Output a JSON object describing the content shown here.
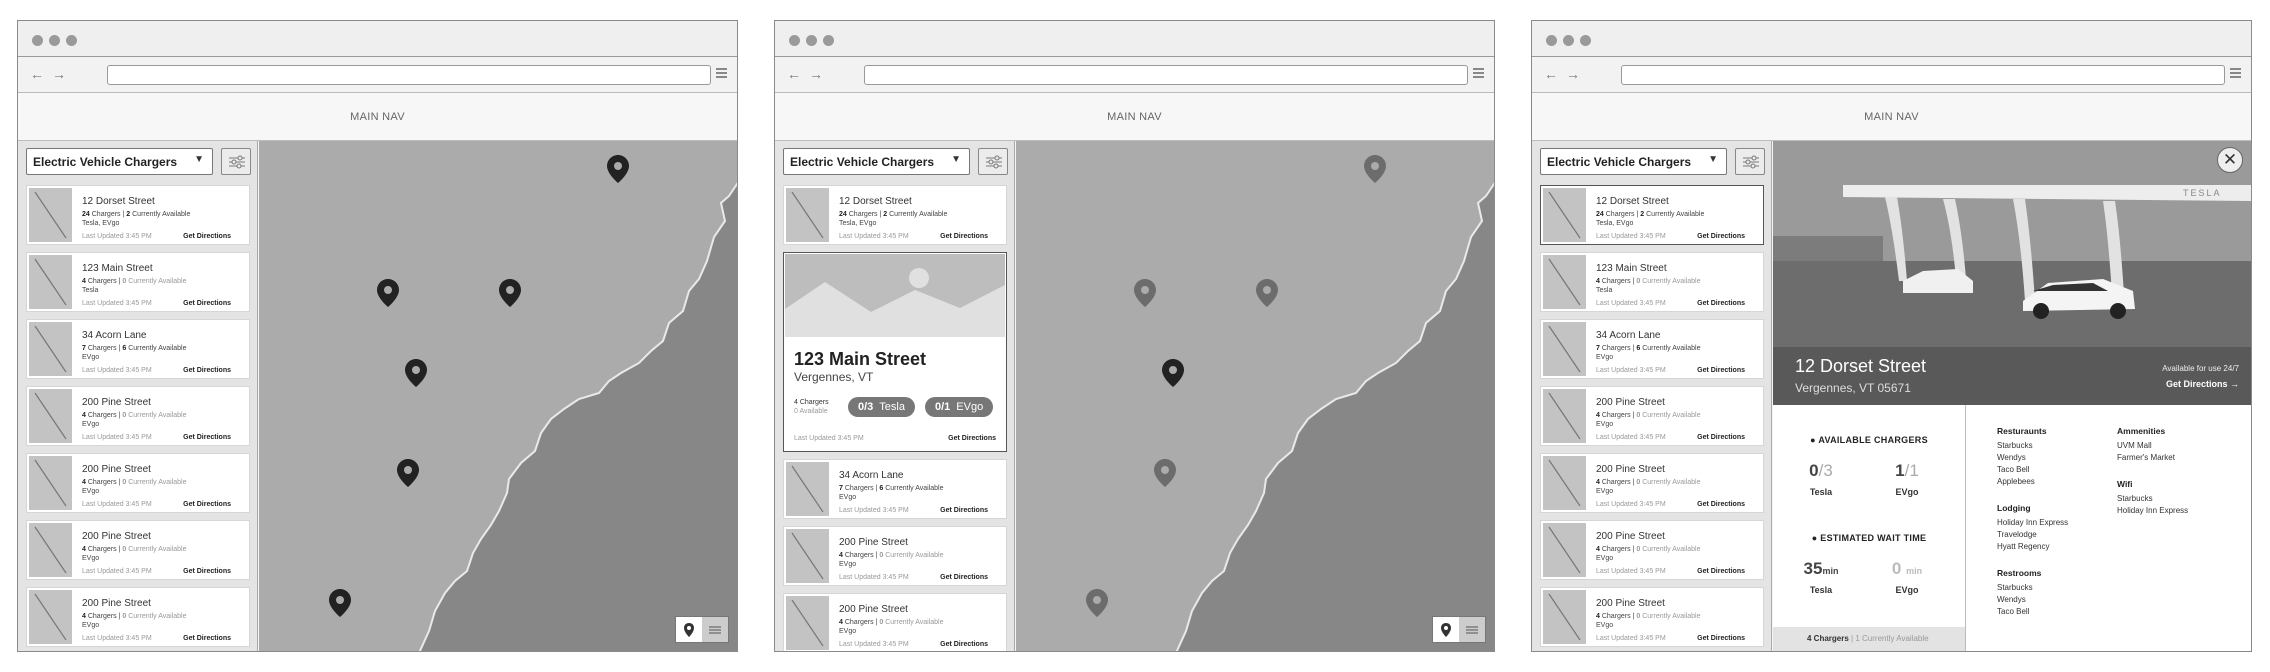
{
  "browser": {
    "nav_label": "MAIN NAV",
    "back_icon": "←",
    "forward_icon": "→"
  },
  "sidebar": {
    "select_value": "Electric Vehicle Chargers"
  },
  "list": [
    {
      "street": "12 Dorset Street",
      "chargers": "24",
      "chargers_label": "Chargers |",
      "available": "2",
      "available_label": "Currently Available",
      "networks": "Tesla, EVgo",
      "updated": "Last Updated 3:45 PM",
      "directions": "Get Directions"
    },
    {
      "street": "123 Main Street",
      "chargers": "4",
      "chargers_label": "Chargers |",
      "available": "0",
      "available_label": "Currently Available",
      "networks": "Tesla",
      "updated": "Last Updated 3:45 PM",
      "directions": "Get Directions"
    },
    {
      "street": "34 Acorn Lane",
      "chargers": "7",
      "chargers_label": "Chargers |",
      "available": "6",
      "available_label": "Currently Available",
      "networks": "EVgo",
      "updated": "Last Updated 3:45 PM",
      "directions": "Get Directions"
    },
    {
      "street": "200 Pine Street",
      "chargers": "4",
      "chargers_label": "Chargers |",
      "available": "0",
      "available_label": "Currently Available",
      "networks": "EVgo",
      "updated": "Last Updated 3:45 PM",
      "directions": "Get Directions"
    },
    {
      "street": "200 Pine Street",
      "chargers": "4",
      "chargers_label": "Chargers |",
      "available": "0",
      "available_label": "Currently Available",
      "networks": "EVgo",
      "updated": "Last Updated 3:45 PM",
      "directions": "Get Directions"
    },
    {
      "street": "200 Pine Street",
      "chargers": "4",
      "chargers_label": "Chargers |",
      "available": "0",
      "available_label": "Currently Available",
      "networks": "EVgo",
      "updated": "Last Updated 3:45 PM",
      "directions": "Get Directions"
    },
    {
      "street": "200 Pine Street",
      "chargers": "4",
      "chargers_label": "Chargers |",
      "available": "0",
      "available_label": "Currently Available",
      "networks": "EVgo",
      "updated": "Last Updated 3:45 PM",
      "directions": "Get Directions"
    }
  ],
  "expanded": {
    "title": "123 Main Street",
    "city": "Vergennes, VT",
    "chargers_line": "4 Chargers",
    "available_line": "0 Available",
    "pill1": {
      "count": "0/3",
      "network": "Tesla"
    },
    "pill2": {
      "count": "0/1",
      "network": "EVgo"
    },
    "updated": "Last Updated 3:45 PM",
    "directions": "Get Directions"
  },
  "detail": {
    "title": "12 Dorset Street",
    "address": "Vergennes, VT 05671",
    "availability": "Available for use 24/7",
    "directions": "Get Directions →",
    "photo_sign": "TESLA",
    "close_icon": "✕",
    "available_header": "AVAILABLE CHARGERS",
    "tesla_avail": "0",
    "tesla_total": "/3",
    "evgo_avail": "1",
    "evgo_total": "/1",
    "wait_header": "ESTIMATED WAIT TIME",
    "tesla_wait": "35",
    "evgo_wait": "0",
    "wait_unit": "min",
    "tesla_label": "Tesla",
    "evgo_label": "EVgo",
    "footer_chargers": "4 Chargers",
    "footer_sep": "|",
    "footer_available": "1 Currently Available",
    "restaurants_title": "Resturaunts",
    "restaurants": [
      "Starbucks",
      "Wendys",
      "Taco Bell",
      "Applebees"
    ],
    "lodging_title": "Lodging",
    "lodging": [
      "Holiday Inn Express",
      "Travelodge",
      "Hyatt Regency"
    ],
    "restrooms_title": "Restrooms",
    "restrooms": [
      "Starbucks",
      "Wendys",
      "Taco Bell"
    ],
    "amenities_title": "Ammenities",
    "amenities": [
      "UVM Mall",
      "Farmer's Market"
    ],
    "wifi_title": "Wifi",
    "wifi": [
      "Starbucks",
      "Holiday Inn Express"
    ]
  },
  "icons": [
    "map-pin-icon",
    "list-icon",
    "filter-icon",
    "chevron-down-icon",
    "close-icon",
    "menu-icon",
    "image-placeholder-icon",
    "plus-circle-icon",
    "clock-icon"
  ]
}
